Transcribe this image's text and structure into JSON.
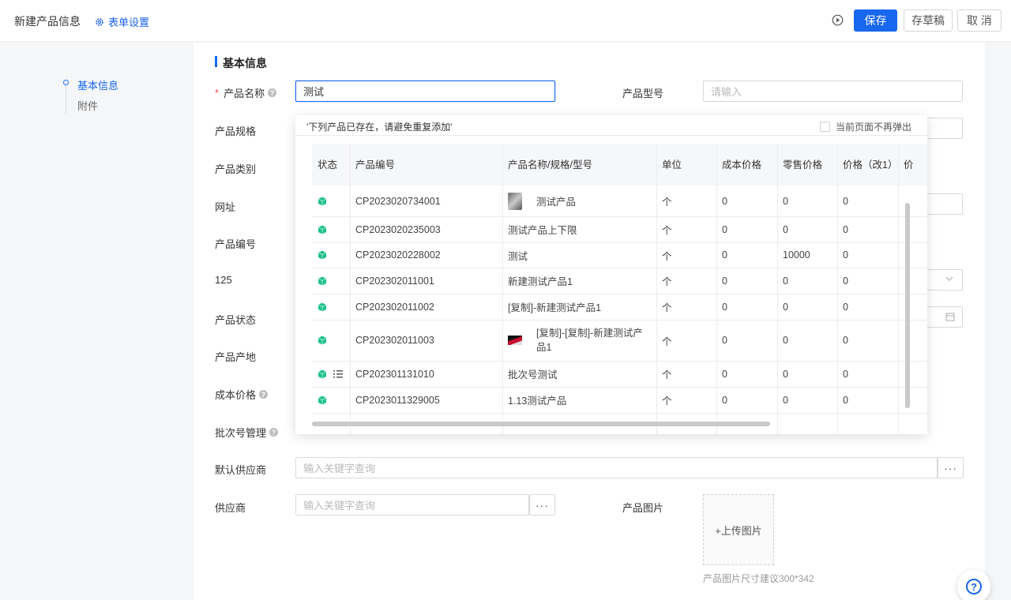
{
  "header": {
    "title": "新建产品信息",
    "form_settings": "表单设置",
    "save": "保存",
    "draft": "存草稿",
    "cancel": "取 消"
  },
  "sidenav": {
    "items": [
      "基本信息",
      "附件"
    ]
  },
  "section": {
    "title": "基本信息"
  },
  "form": {
    "product_name": {
      "label": "产品名称",
      "value": "测试"
    },
    "product_model": {
      "label": "产品型号",
      "placeholder": "请输入"
    },
    "labels": [
      "产品规格",
      "产品类别",
      "网址",
      "产品编号",
      "125",
      "产品状态",
      "产品产地",
      "成本价格",
      "批次号管理"
    ],
    "default_supplier": {
      "label": "默认供应商",
      "placeholder": "输入关键字查询"
    },
    "supplier": {
      "label": "供应商",
      "placeholder": "输入关键字查询"
    },
    "product_image": {
      "label": "产品图片",
      "upload": "+上传图片",
      "hint": "产品图片尺寸建议300*342"
    }
  },
  "popup": {
    "warning": "'下列产品已存在，请避免重复添加'",
    "no_popup": "当前页面不再弹出",
    "columns": [
      "状态",
      "产品编号",
      "产品名称/规格/型号",
      "单位",
      "成本价格",
      "零售价格",
      "价格（改1）",
      "价"
    ],
    "rows": [
      {
        "code": "CP2023020734001",
        "name": "测试产品",
        "unit": "个",
        "cost": "0",
        "retail": "0",
        "price1": "0"
      },
      {
        "code": "CP2023020235003",
        "name": "测试产品上下限",
        "unit": "个",
        "cost": "0",
        "retail": "0",
        "price1": "0"
      },
      {
        "code": "CP2023020228002",
        "name": "测试",
        "unit": "个",
        "cost": "0",
        "retail": "10000",
        "price1": "0"
      },
      {
        "code": "CP202302011001",
        "name": "新建测试产品1",
        "unit": "个",
        "cost": "0",
        "retail": "0",
        "price1": "0"
      },
      {
        "code": "CP202302011002",
        "name": "[复制]-新建测试产品1",
        "unit": "个",
        "cost": "0",
        "retail": "0",
        "price1": "0"
      },
      {
        "code": "CP202302011003",
        "name": "[复制]-[复制]-新建测试产品1",
        "unit": "个",
        "cost": "0",
        "retail": "0",
        "price1": "0"
      },
      {
        "code": "CP202301131010",
        "name": "批次号测试",
        "unit": "个",
        "cost": "0",
        "retail": "0",
        "price1": "0"
      },
      {
        "code": "CP2023011329005",
        "name": "1.13测试产品",
        "unit": "个",
        "cost": "0",
        "retail": "0",
        "price1": "0"
      }
    ]
  },
  "colors": {
    "primary": "#1867ef",
    "cube_green": "#1fc28a"
  }
}
